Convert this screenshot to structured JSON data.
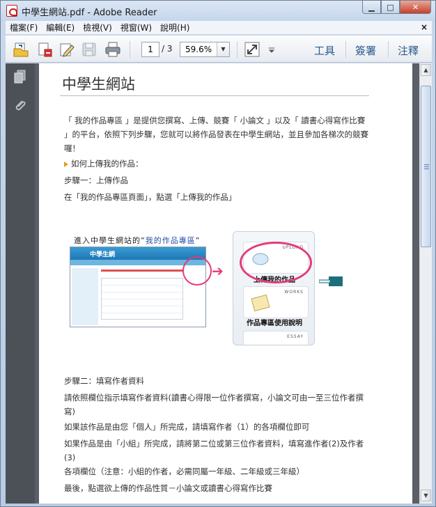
{
  "window": {
    "title": "中學生網站.pdf - Adobe Reader",
    "controls": {
      "minimize": "▁",
      "maximize": "□",
      "close": "✕"
    }
  },
  "menu": {
    "items": [
      "檔案(F)",
      "編輯(E)",
      "檢視(V)",
      "視窗(W)",
      "說明(H)"
    ],
    "close": "×"
  },
  "toolbar": {
    "page_current": "1",
    "page_total": "/ 3",
    "zoom": "59.6%",
    "links": [
      "工具",
      "簽署",
      "注釋"
    ]
  },
  "document": {
    "title": "中學生網站",
    "paragraphs": [
      "「 我的作品專區 」是提供您撰寫、上傳、競賽「 小論文 」以及「 讀書心得寫作比賽 」的平台，依照下列步驟，您就可以將作品發表在中學生網站，並且參加各梯次的競賽囉！",
      "如何上傳我的作品：",
      "步驟一：上傳作品",
      "在「我的作品專區頁面」，點選「上傳我的作品」"
    ],
    "illustration": {
      "caption_prefix": "進入中學生網站的”",
      "caption_highlight": "我的作品專區",
      "caption_suffix": "”",
      "shot_header": "中學生網",
      "card_tags": [
        "UPLOAD",
        "WORKS",
        "ESSAY"
      ],
      "card_labels": [
        "上傳我的作品",
        "作品專區使用說明"
      ]
    },
    "paragraphs2": [
      "步驟二：填寫作者資料",
      "請依照欄位指示填寫作者資料(讀書心得限一位作者撰寫，小論文可由一至三位作者撰寫)",
      "如果該作品是由您「個人」所完成，請填寫作者（1）的各項欄位即可",
      "如果作品是由「小組」所完成，請將第二位或第三位作者資料，填寫進作者(2)及作者(3)",
      "各項欄位（注意：小組的作者，必需同屬一年級、二年級或三年級）",
      "最後，點選欲上傳的作品性質－小論文或讀書心得寫作比賽"
    ]
  },
  "colors": {
    "accent": "#e43b78",
    "link": "#2c5c8c",
    "nav_panel": "#4c5158",
    "doc_bg": "#5b5f66"
  }
}
